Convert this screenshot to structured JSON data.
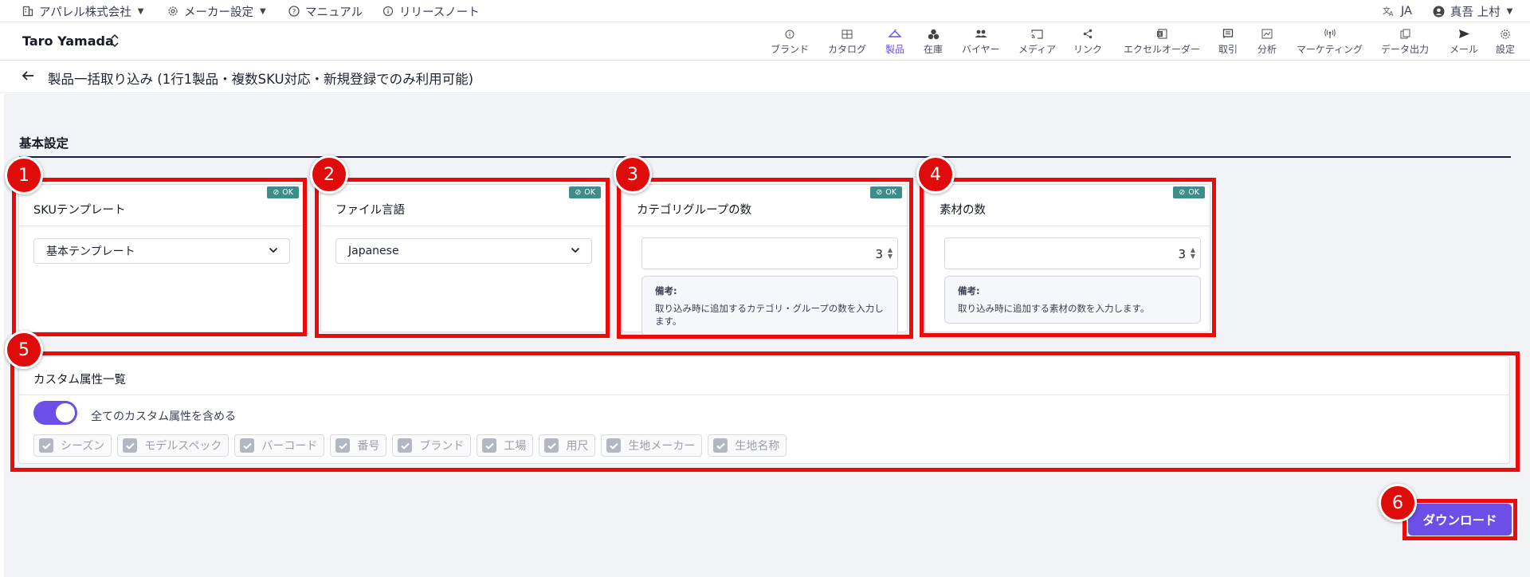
{
  "topbar": {
    "company": "アパレル株式会社",
    "maker_settings": "メーカー設定",
    "manual": "マニュアル",
    "release_notes": "リリースノート",
    "language": "JA",
    "user": "真吾 上村"
  },
  "navbar": {
    "user_name": "Taro Yamada",
    "items": [
      {
        "label": "ブランド",
        "icon": "info-icon"
      },
      {
        "label": "カタログ",
        "icon": "catalog-icon"
      },
      {
        "label": "製品",
        "icon": "hanger-icon",
        "active": true
      },
      {
        "label": "在庫",
        "icon": "stock-icon"
      },
      {
        "label": "バイヤー",
        "icon": "people-icon"
      },
      {
        "label": "メディア",
        "icon": "cast-icon"
      },
      {
        "label": "リンク",
        "icon": "share-icon"
      },
      {
        "label": "エクセルオーダー",
        "icon": "excel-icon"
      },
      {
        "label": "取引",
        "icon": "receipt-icon"
      },
      {
        "label": "分析",
        "icon": "chart-icon"
      },
      {
        "label": "マーケティング",
        "icon": "broadcast-icon"
      },
      {
        "label": "データ出力",
        "icon": "export-icon"
      },
      {
        "label": "メール",
        "icon": "send-icon"
      },
      {
        "label": "設定",
        "icon": "gear-icon"
      }
    ]
  },
  "page": {
    "title": "製品一括取り込み (1行1製品・複数SKU対応・新規登録でのみ利用可能)",
    "section_title": "基本設定"
  },
  "cards": {
    "sku_template": {
      "title": "SKUテンプレート",
      "badge": "OK",
      "value": "基本テンプレート"
    },
    "file_language": {
      "title": "ファイル言語",
      "badge": "OK",
      "value": "Japanese"
    },
    "category_groups": {
      "title": "カテゴリグループの数",
      "badge": "OK",
      "value": "3",
      "note_title": "備考:",
      "note_text": "取り込み時に追加するカテゴリ・グループの数を入力します。"
    },
    "materials": {
      "title": "素材の数",
      "badge": "OK",
      "value": "3",
      "note_title": "備考:",
      "note_text": "取り込み時に追加する素材の数を入力します。"
    }
  },
  "custom_attributes": {
    "title": "カスタム属性一覧",
    "toggle_label": "全てのカスタム属性を含める",
    "toggle_on": true,
    "chips": [
      "シーズン",
      "モデルスペック",
      "バーコード",
      "番号",
      "ブランド",
      "工場",
      "用尺",
      "生地メーカー",
      "生地名称"
    ]
  },
  "download_label": "ダウンロード",
  "markers": [
    "1",
    "2",
    "3",
    "4",
    "5",
    "6"
  ],
  "colors": {
    "accent": "#6b4fe6",
    "ok_badge": "#3e8d88",
    "highlight": "#ef0a0a",
    "marker": "#e00b0b"
  }
}
